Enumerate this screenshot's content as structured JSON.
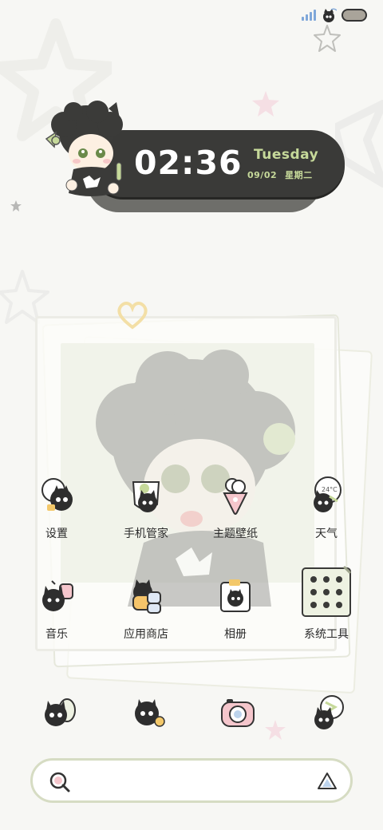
{
  "status_bar": {
    "signal_icon": "signal-bars-icon",
    "wifi_cat_icon": "cat-wifi-icon",
    "battery_icon": "battery-icon"
  },
  "clock_widget": {
    "time": "02:36",
    "weekday": "Tuesday",
    "date": "09/02",
    "weekday_cn": "星期二",
    "accent_color": "#c6d99a",
    "band_color": "#3a3a38"
  },
  "apps": [
    {
      "label": "设置",
      "icon": "settings-cat-icon"
    },
    {
      "label": "手机管家",
      "icon": "phone-manager-cat-icon"
    },
    {
      "label": "主题壁纸",
      "icon": "theme-wallpaper-icon"
    },
    {
      "label": "天气",
      "icon": "weather-icon"
    },
    {
      "label": "音乐",
      "icon": "music-icon"
    },
    {
      "label": "应用商店",
      "icon": "app-store-icon"
    },
    {
      "label": "相册",
      "icon": "gallery-icon"
    },
    {
      "label": "系统工具",
      "icon": "system-tools-folder-icon"
    }
  ],
  "weather_icon_text": "24°C",
  "dock": [
    {
      "icon": "phone-cat-icon"
    },
    {
      "icon": "messages-cat-icon"
    },
    {
      "icon": "camera-icon"
    },
    {
      "icon": "browser-cat-icon"
    }
  ],
  "search": {
    "placeholder": "",
    "search_icon": "search-icon",
    "assistant_icon": "assistant-icon"
  }
}
